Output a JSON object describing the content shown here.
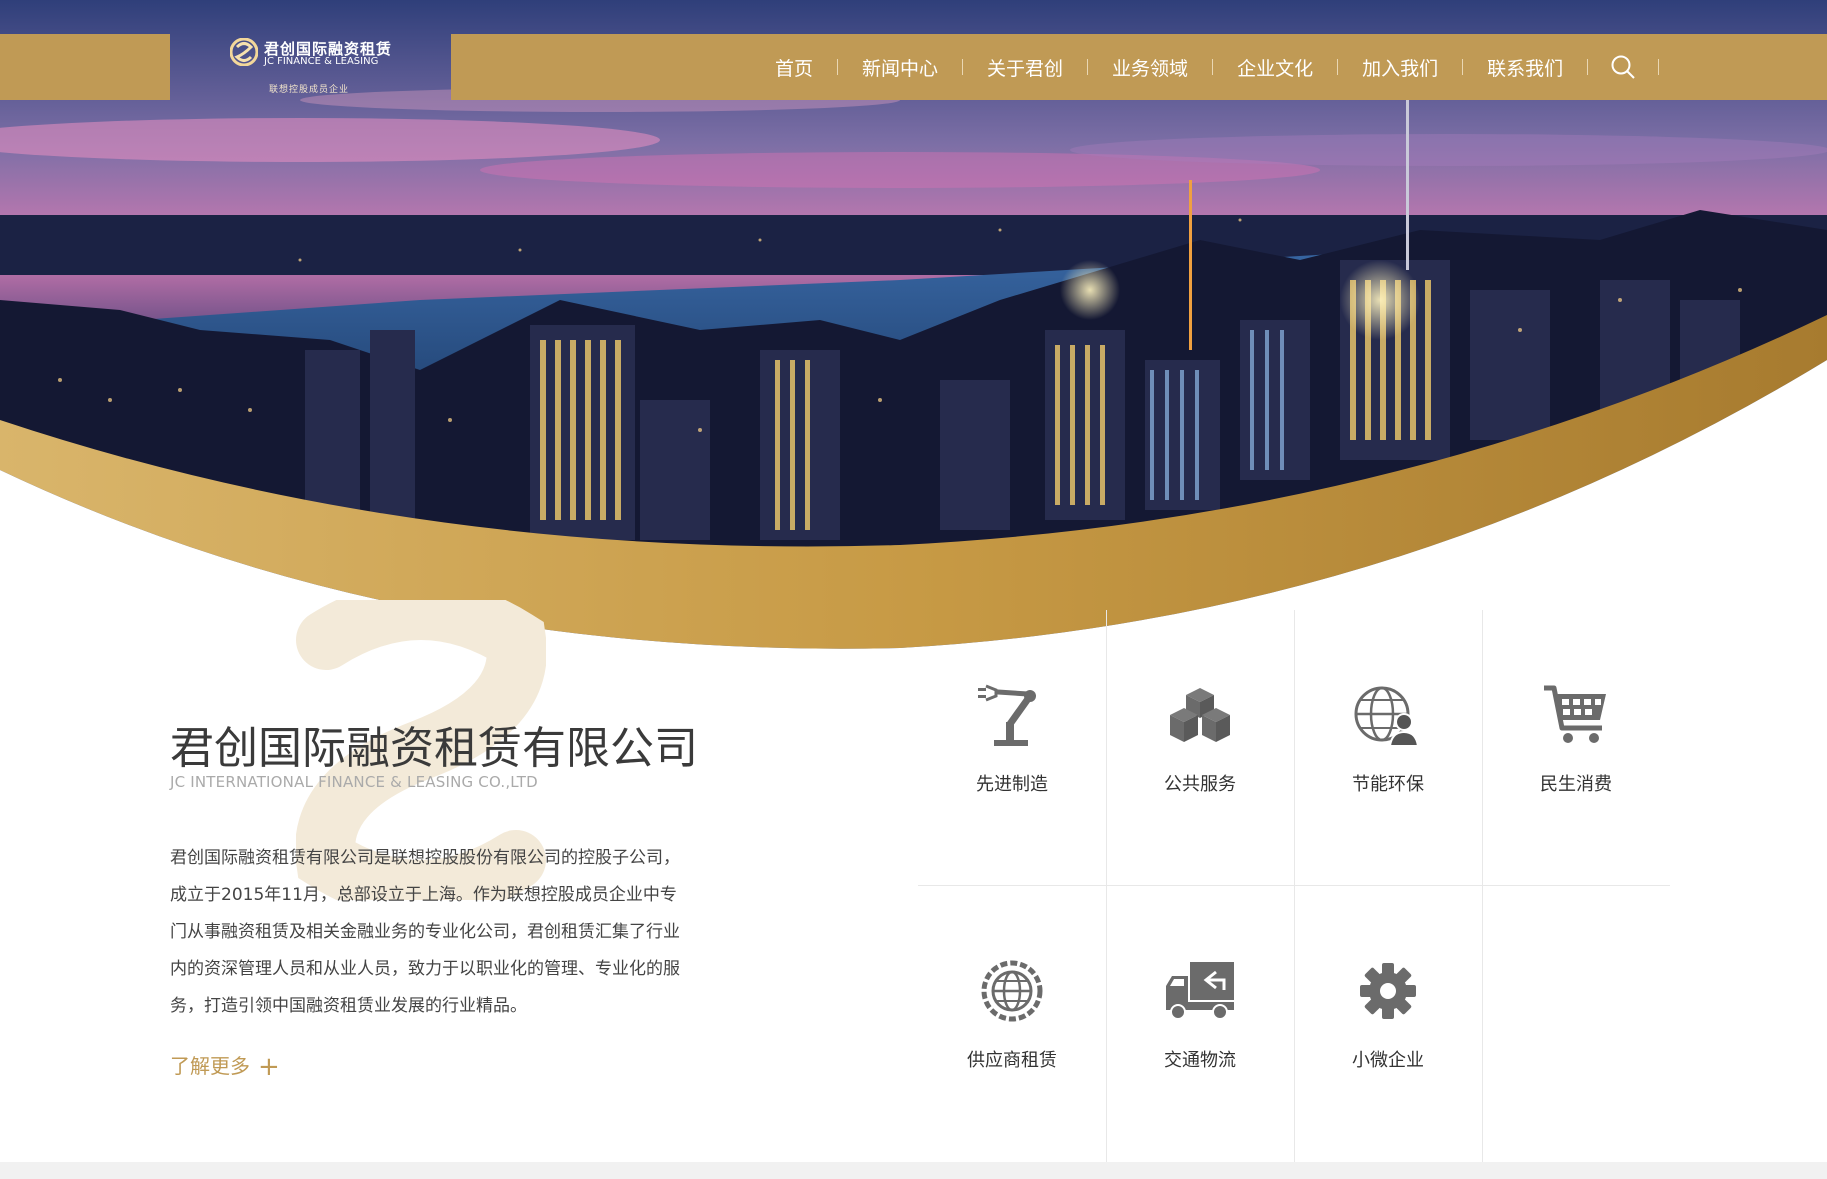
{
  "header": {
    "logo_cn": "君创国际融资租赁",
    "logo_en": "JC FINANCE & LEASING",
    "logo_sub": "联想控股成员企业",
    "nav": [
      {
        "label": "首页"
      },
      {
        "label": "新闻中心"
      },
      {
        "label": "关于君创"
      },
      {
        "label": "业务领域"
      },
      {
        "label": "企业文化"
      },
      {
        "label": "加入我们"
      },
      {
        "label": "联系我们"
      }
    ],
    "search_icon": "search-icon"
  },
  "intro": {
    "title": "君创国际融资租赁有限公司",
    "subtitle": "JC INTERNATIONAL FINANCE & LEASING CO.,LTD",
    "body": "君创国际融资租赁有限公司是联想控股股份有限公司的控股子公司，成立于2015年11月，总部设立于上海。作为联想控股成员企业中专门从事融资租赁及相关金融业务的专业化公司，君创租赁汇集了行业内的资深管理人员和从业人员，致力于以职业化的管理、专业化的服务，打造引领中国融资租赁业发展的行业精品。",
    "more_label": "了解更多"
  },
  "business": [
    {
      "label": "先进制造",
      "icon": "robot-arm-icon"
    },
    {
      "label": "公共服务",
      "icon": "boxes-icon"
    },
    {
      "label": "节能环保",
      "icon": "globe-person-icon"
    },
    {
      "label": "民生消费",
      "icon": "shopping-cart-icon"
    },
    {
      "label": "供应商租赁",
      "icon": "globe-gear-icon"
    },
    {
      "label": "交通物流",
      "icon": "truck-icon"
    },
    {
      "label": "小微企业",
      "icon": "gear-icon"
    }
  ],
  "colors": {
    "gold": "#c09a55",
    "text_dark": "#3a3a3a",
    "icon_gray": "#6b6b6b"
  }
}
